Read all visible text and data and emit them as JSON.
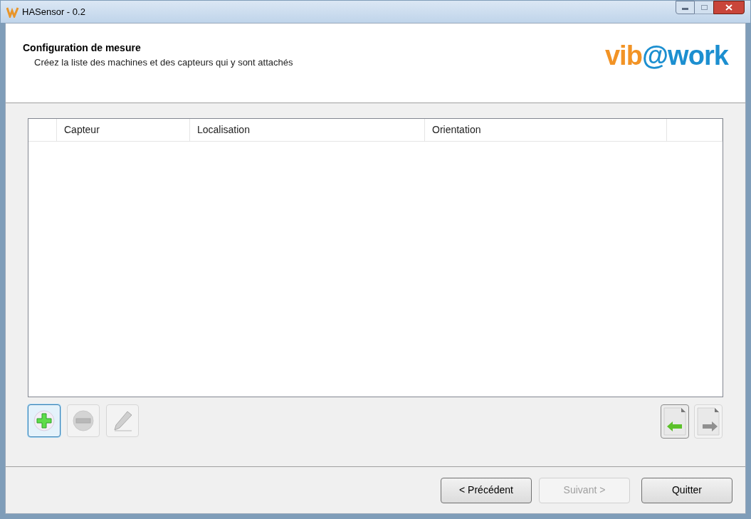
{
  "window": {
    "title": "HASensor - 0.2"
  },
  "header": {
    "title": "Configuration de mesure",
    "subtitle": "Créez la liste des machines et des capteurs qui y sont attachés",
    "logo": {
      "part_1": "vib",
      "part_2": "@work"
    }
  },
  "table": {
    "columns": [
      "",
      "Capteur",
      "Localisation",
      "Orientation",
      ""
    ]
  },
  "toolbar_left": [
    {
      "kind": "add",
      "disabled": false,
      "focused": true
    },
    {
      "kind": "remove",
      "disabled": true,
      "focused": false
    },
    {
      "kind": "edit",
      "disabled": true,
      "focused": false
    }
  ],
  "toolbar_right": [
    {
      "kind": "import",
      "disabled": false,
      "focused": false
    },
    {
      "kind": "export",
      "disabled": true,
      "focused": false
    }
  ],
  "buttons": [
    {
      "label": "< Précédent",
      "disabled": false
    },
    {
      "label": "Suivant >",
      "disabled": true
    },
    {
      "label": "Quitter",
      "disabled": false
    }
  ]
}
